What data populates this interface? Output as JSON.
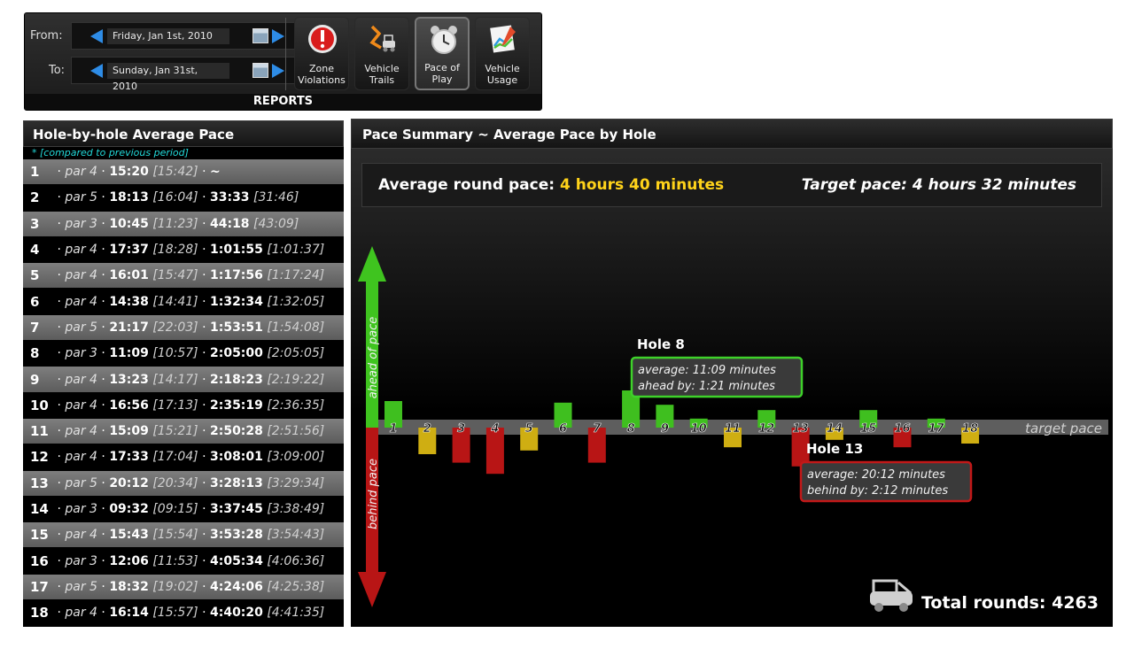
{
  "toolbar": {
    "from_label": "From:",
    "to_label": "To:",
    "from_date": "Friday, Jan 1st, 2010",
    "to_date": "Sunday, Jan 31st, 2010",
    "buttons": [
      {
        "label": "Zone\nViolations",
        "icon": "alert-icon"
      },
      {
        "label": "Vehicle\nTrails",
        "icon": "trails-icon"
      },
      {
        "label": "Pace of\nPlay",
        "icon": "alarm-clock-icon",
        "active": true
      },
      {
        "label": "Vehicle\nUsage",
        "icon": "usage-chart-icon"
      }
    ],
    "section": "REPORTS"
  },
  "left_panel": {
    "title": "Hole-by-hole Average Pace",
    "note": "* [compared to previous period]",
    "rows": [
      {
        "hole": "1",
        "par": "par 4",
        "time": "15:20",
        "prev": "[15:42]",
        "cum": "~",
        "cum_prev": ""
      },
      {
        "hole": "2",
        "par": "par 5",
        "time": "18:13",
        "prev": "[16:04]",
        "cum": "33:33",
        "cum_prev": "[31:46]"
      },
      {
        "hole": "3",
        "par": "par 3",
        "time": "10:45",
        "prev": "[11:23]",
        "cum": "44:18",
        "cum_prev": "[43:09]"
      },
      {
        "hole": "4",
        "par": "par 4",
        "time": "17:37",
        "prev": "[18:28]",
        "cum": "1:01:55",
        "cum_prev": "[1:01:37]"
      },
      {
        "hole": "5",
        "par": "par 4",
        "time": "16:01",
        "prev": "[15:47]",
        "cum": "1:17:56",
        "cum_prev": "[1:17:24]"
      },
      {
        "hole": "6",
        "par": "par 4",
        "time": "14:38",
        "prev": "[14:41]",
        "cum": "1:32:34",
        "cum_prev": "[1:32:05]"
      },
      {
        "hole": "7",
        "par": "par 5",
        "time": "21:17",
        "prev": "[22:03]",
        "cum": "1:53:51",
        "cum_prev": "[1:54:08]"
      },
      {
        "hole": "8",
        "par": "par 3",
        "time": "11:09",
        "prev": "[10:57]",
        "cum": "2:05:00",
        "cum_prev": "[2:05:05]"
      },
      {
        "hole": "9",
        "par": "par 4",
        "time": "13:23",
        "prev": "[14:17]",
        "cum": "2:18:23",
        "cum_prev": "[2:19:22]"
      },
      {
        "hole": "10",
        "par": "par 4",
        "time": "16:56",
        "prev": "[17:13]",
        "cum": "2:35:19",
        "cum_prev": "[2:36:35]"
      },
      {
        "hole": "11",
        "par": "par 4",
        "time": "15:09",
        "prev": "[15:21]",
        "cum": "2:50:28",
        "cum_prev": "[2:51:56]"
      },
      {
        "hole": "12",
        "par": "par 4",
        "time": "17:33",
        "prev": "[17:04]",
        "cum": "3:08:01",
        "cum_prev": "[3:09:00]"
      },
      {
        "hole": "13",
        "par": "par 5",
        "time": "20:12",
        "prev": "[20:34]",
        "cum": "3:28:13",
        "cum_prev": "[3:29:34]"
      },
      {
        "hole": "14",
        "par": "par 3",
        "time": "09:32",
        "prev": "[09:15]",
        "cum": "3:37:45",
        "cum_prev": "[3:38:49]"
      },
      {
        "hole": "15",
        "par": "par 4",
        "time": "15:43",
        "prev": "[15:54]",
        "cum": "3:53:28",
        "cum_prev": "[3:54:43]"
      },
      {
        "hole": "16",
        "par": "par 3",
        "time": "12:06",
        "prev": "[11:53]",
        "cum": "4:05:34",
        "cum_prev": "[4:06:36]"
      },
      {
        "hole": "17",
        "par": "par 5",
        "time": "18:32",
        "prev": "[19:02]",
        "cum": "4:24:06",
        "cum_prev": "[4:25:38]"
      },
      {
        "hole": "18",
        "par": "par 4",
        "time": "16:14",
        "prev": "[15:57]",
        "cum": "4:40:20",
        "cum_prev": "[4:41:35]"
      }
    ]
  },
  "main_panel": {
    "title": "Pace Summary ~ Average Pace by Hole",
    "avg_label": "Average round pace: ",
    "avg_value": "4 hours 40 minutes",
    "target_label": "Target pace: 4 hours 32 minutes",
    "total_label": "Total rounds: 4263",
    "ahead_label": "ahead of pace",
    "behind_label": "behind pace",
    "target_line_label": "target pace",
    "callouts": [
      {
        "hole": 8,
        "title": "Hole 8",
        "line1": "average: 11:09 minutes",
        "line2": "ahead by: 1:21 minutes",
        "color": "#3ed12a"
      },
      {
        "hole": 13,
        "title": "Hole 13",
        "line1": "average: 20:12 minutes",
        "line2": "behind by: 2:12 minutes",
        "color": "#c21818"
      }
    ]
  },
  "colors": {
    "ahead": "#3fbf1f",
    "slightly_behind": "#cfae12",
    "behind": "#b81515",
    "accent_yellow": "#ffd31a",
    "note_cyan": "#22d8d8"
  },
  "chart_data": {
    "type": "bar",
    "title": "Pace Summary ~ Average Pace by Hole",
    "categories": [
      "1",
      "2",
      "3",
      "4",
      "5",
      "6",
      "7",
      "8",
      "9",
      "10",
      "11",
      "12",
      "13",
      "14",
      "15",
      "16",
      "17",
      "18"
    ],
    "values": [
      0.5,
      -0.5,
      -0.66,
      -0.87,
      -0.43,
      0.47,
      -0.66,
      0.7,
      0.43,
      0.17,
      -0.37,
      0.33,
      -0.73,
      -0.23,
      0.33,
      -0.37,
      0.17,
      -0.3
    ],
    "status": [
      "ahead",
      "slightly_behind",
      "behind",
      "behind",
      "slightly_behind",
      "ahead",
      "behind",
      "ahead",
      "ahead",
      "ahead",
      "slightly_behind",
      "ahead",
      "behind",
      "slightly_behind",
      "ahead",
      "behind",
      "ahead",
      "slightly_behind"
    ],
    "ylabel": "",
    "baseline_label": "target pace"
  }
}
